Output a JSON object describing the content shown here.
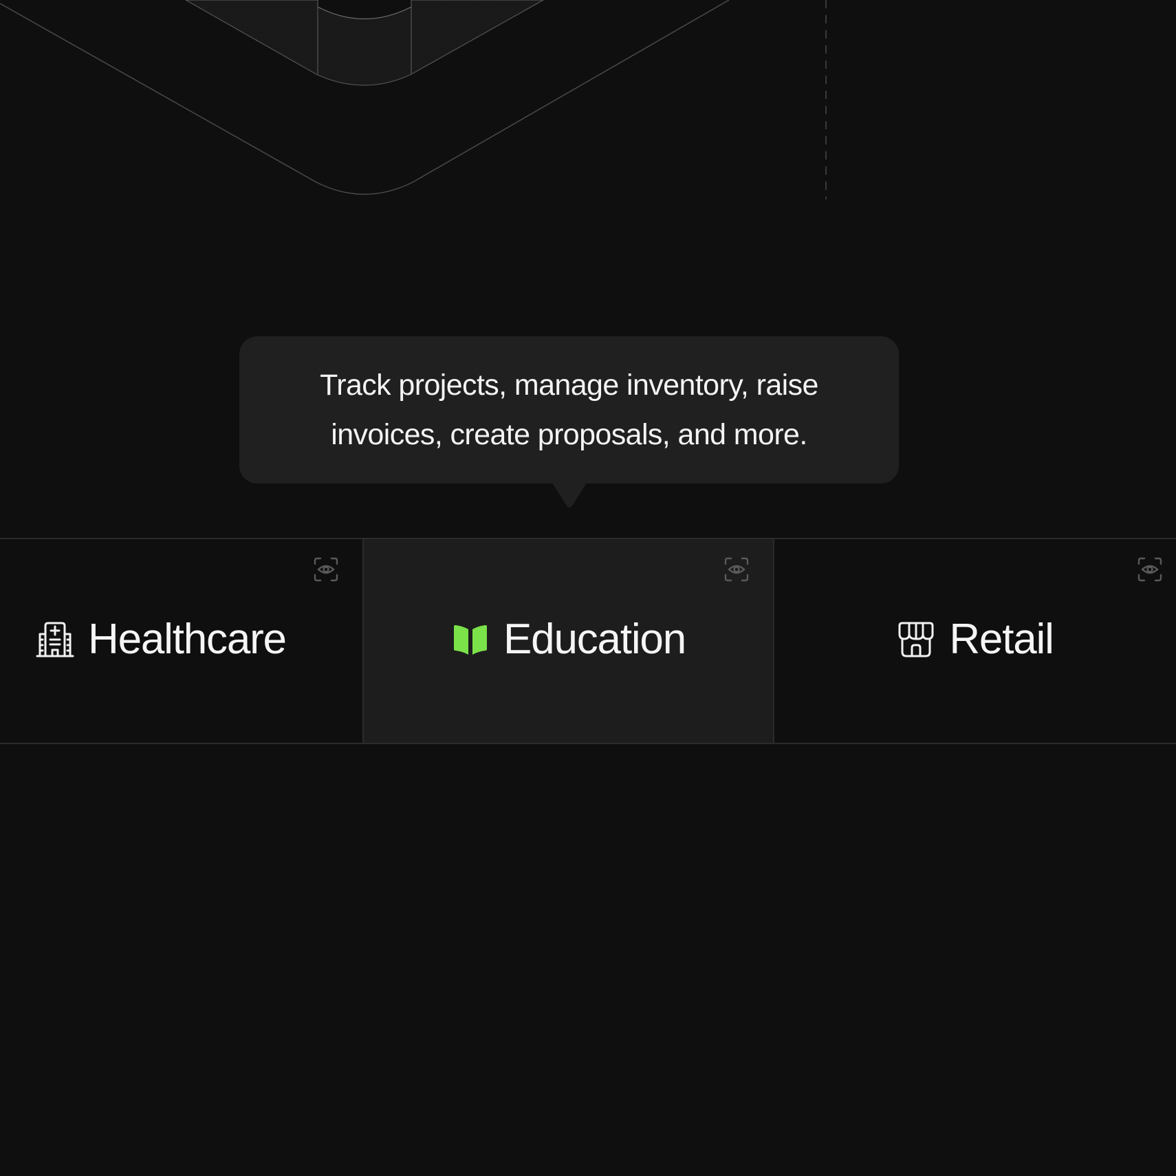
{
  "tooltip": {
    "text": "Track projects, manage inventory, raise invoices, create proposals, and more."
  },
  "tabs": [
    {
      "label": "Healthcare",
      "icon": "hospital-icon",
      "active": false
    },
    {
      "label": "Education",
      "icon": "book-icon",
      "active": true
    },
    {
      "label": "Retail",
      "icon": "store-icon",
      "active": false
    }
  ],
  "colors": {
    "background": "#0f0f0f",
    "tooltip_bg": "#202020",
    "active_tab_bg": "#1d1d1d",
    "accent": "#7ce24a",
    "border": "#2b2b2b"
  }
}
